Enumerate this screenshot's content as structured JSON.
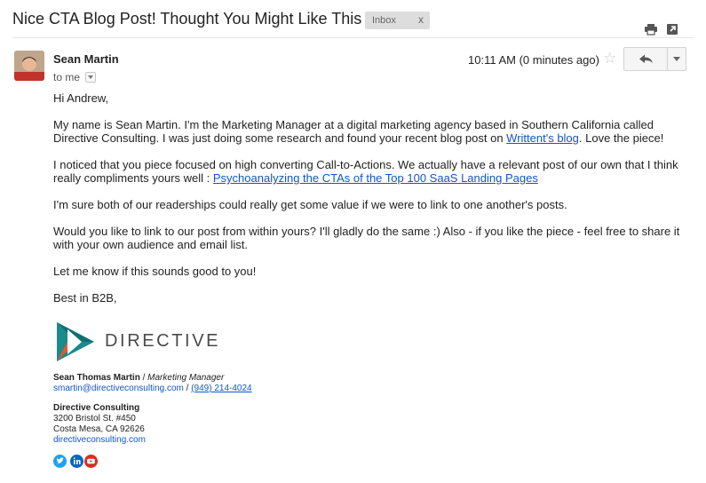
{
  "header": {
    "subject": "Nice CTA Blog Post! Thought You Might Like This",
    "label": "Inbox",
    "label_remove": "x",
    "icons": [
      "print-icon",
      "open-in-new-window-icon"
    ]
  },
  "message": {
    "sender_name": "Sean Martin",
    "recipient": "to me",
    "time": "10:11 AM (0 minutes ago)",
    "star_icon": "star-icon",
    "reply_icon": "reply-icon",
    "more_icon": "dropdown-arrow-icon",
    "greeting": "Hi Andrew,",
    "p1_before": "My name is Sean Martin. I'm the Marketing Manager at a digital marketing agency based in Southern California called Directive Consulting. I was just doing some research and found your recent blog post on ",
    "p1_link": "Writtent's blog",
    "p1_after": ". Love the piece!",
    "p2_before": "I noticed that you piece focused on high converting Call-to-Actions. We actually have a relevant post of our own that I think really compliments yours well : ",
    "p2_link": "Psychoanalyzing the CTAs of the Top 100 SaaS Landing Pages",
    "p3": "I'm sure both of our readerships could really get some value if we were to link to one another's posts.",
    "p4": "Would you like to link to our post from within yours? I'll gladly do the same :) Also - if you like the piece - feel free to share it with your own audience and email list.",
    "p5": "Let me know if this sounds good to you!",
    "closing": "Best in B2B,"
  },
  "signature": {
    "logo_text": "DIRECTIVE",
    "name": "Sean Thomas Martin",
    "title_sep": " / ",
    "title": "Marketing Manager",
    "email": "smartin@directiveconsulting.com",
    "contact_sep": " / ",
    "phone": "(949) 214-4024",
    "company": "Directive Consulting",
    "address1": "3200 Bristol St. #450",
    "address2": "Costa Mesa, CA 92626",
    "website": "directiveconsulting.com",
    "social_icons": [
      "twitter-icon",
      "linkedin-icon",
      "youtube-icon"
    ]
  },
  "colors": {
    "link": "#1155cc",
    "label_bg": "#dddddd",
    "logo_teal": "#1a8a8a",
    "logo_orange": "#e8582a",
    "twitter": "#1da1f2",
    "linkedin": "#0a66c2",
    "youtube": "#e02b20"
  }
}
